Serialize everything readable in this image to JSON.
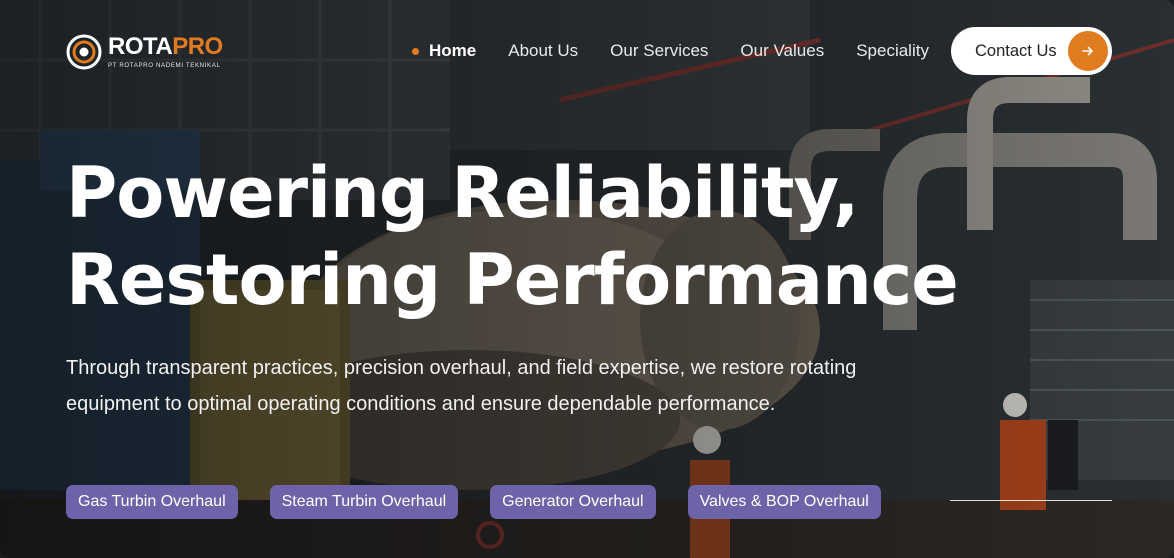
{
  "brand": {
    "name_primary": "ROTA",
    "name_accent": "PRO",
    "subtitle": "PT ROTAPRO NADEMI TEKNIKAL",
    "accent_color": "#e07b1f"
  },
  "nav": {
    "items": [
      {
        "label": "Home",
        "active": true
      },
      {
        "label": "About Us",
        "active": false
      },
      {
        "label": "Our Services",
        "active": false
      },
      {
        "label": "Our Values",
        "active": false
      },
      {
        "label": "Speciality",
        "active": false
      }
    ],
    "contact_label": "Contact Us",
    "contact_icon": "arrow-right-icon"
  },
  "hero": {
    "headline_line1": "Powering Reliability,",
    "headline_line2": "Restoring Performance",
    "lead": "Through transparent practices, precision overhaul, and field expertise, we restore rotating equipment to optimal operating conditions and ensure dependable performance."
  },
  "services": {
    "chips": [
      "Gas Turbin Overhaul",
      "Steam Turbin Overhaul",
      "Generator Overhaul",
      "Valves & BOP Overhaul"
    ],
    "chip_color": "#6c63a8"
  }
}
